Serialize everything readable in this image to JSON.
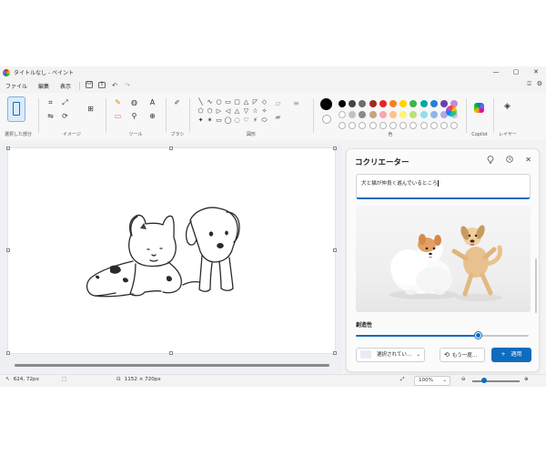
{
  "window": {
    "title": "タイトルなし - ペイント",
    "controls": {
      "minimize": "—",
      "maximize": "▢",
      "close": "✕"
    }
  },
  "menu": {
    "items": [
      "ファイル",
      "編集",
      "表示"
    ],
    "quick_actions": [
      "save-icon",
      "share-icon",
      "undo-icon",
      "redo-icon"
    ],
    "right_icons": [
      "account-icon",
      "settings-icon"
    ]
  },
  "ribbon": {
    "groups": {
      "selection": "選択した部分",
      "image": "イメージ",
      "tools": "ツール",
      "brushes": "ブラシ",
      "shapes": "図形",
      "colors": "色",
      "copilot": "Copilot",
      "layers": "レイヤー"
    },
    "tool_glyphs": {
      "crop": "⌗",
      "resize": "⤢",
      "rotate": "⟳",
      "image_creator": "⊞",
      "pencil": "✎",
      "fill": "◍",
      "text": "A",
      "eraser": "▭",
      "picker": "⚲",
      "magnifier": "⊕",
      "brush": "🖌",
      "layers": "◈",
      "outline": "▱",
      "fill_shape": "▰"
    },
    "shapes": [
      "╲",
      "∿",
      "○",
      "▭",
      "▢",
      "△",
      "◸",
      "◇",
      "⬠",
      "⬡",
      "▷",
      "◁",
      "△",
      "▽",
      "☆",
      "✧",
      "✦",
      "✶",
      "▭",
      "◯",
      "◌",
      "♡",
      "⚡",
      "⬭"
    ],
    "colors": {
      "current": "#000000",
      "row1": [
        "#000000",
        "#444444",
        "#6e6e6e",
        "#9c2b23",
        "#e3242b",
        "#f58025",
        "#ffd200",
        "#3cb54a",
        "#00a99d",
        "#2980d4",
        "#6e3eb0",
        "#c08bd8"
      ],
      "row2": [
        "#ffffff",
        "#c3c3c3",
        "#8a8a8a",
        "#c9a27e",
        "#f7a6b5",
        "#f9c38b",
        "#fff27a",
        "#b6e27a",
        "#8fe0e7",
        "#8fb6e8",
        "#b7a7db",
        "#d9b8e6"
      ]
    }
  },
  "cocreator": {
    "title": "コクリエーター",
    "icons": [
      "lightbulb-icon",
      "history-icon",
      "close-icon"
    ],
    "prompt": "犬と猫が仲良く遊んでいるところ",
    "creativity_label": "創造性",
    "creativity_value": 0.71,
    "style_button": "選択されてい…",
    "retry_button": "もう一度…",
    "apply_button": "適用"
  },
  "status": {
    "cursor_pos": "624, 72px",
    "canvas_size": "1152 × 720px",
    "zoom": "100%",
    "zoom_level": 0.25
  }
}
